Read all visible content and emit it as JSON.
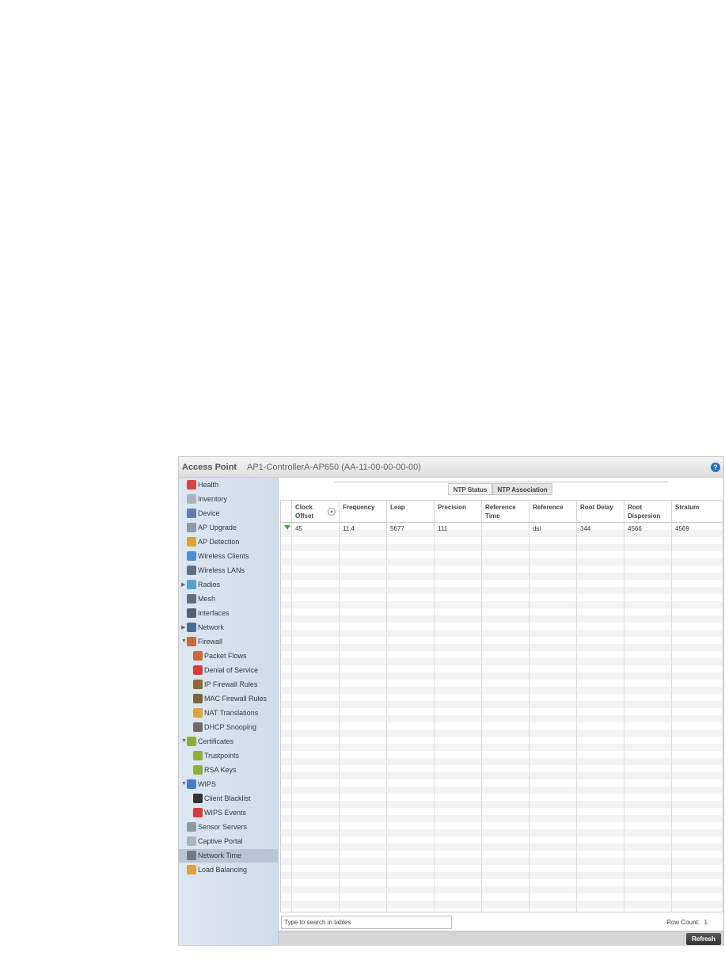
{
  "header": {
    "label": "Access Point",
    "device": "AP1-ControllerA-AP650 (AA-11-00-00-00-00)",
    "help_icon": "?"
  },
  "nav": [
    {
      "label": "Health",
      "icon": "health-icon",
      "color": "#d64545"
    },
    {
      "label": "Inventory",
      "icon": "inventory-icon",
      "color": "#a9b5c2"
    },
    {
      "label": "Device",
      "icon": "device-icon",
      "color": "#5a7fb0"
    },
    {
      "label": "AP Upgrade",
      "icon": "ap-upgrade-icon",
      "color": "#8e9aa6"
    },
    {
      "label": "AP Detection",
      "icon": "ap-detection-icon",
      "color": "#d9a43c"
    },
    {
      "label": "Wireless Clients",
      "icon": "wireless-clients-icon",
      "color": "#4a8fd1"
    },
    {
      "label": "Wireless LANs",
      "icon": "wireless-lans-icon",
      "color": "#607080"
    },
    {
      "label": "Radios",
      "icon": "radios-icon",
      "color": "#5aa0d0",
      "arrow": "▶"
    },
    {
      "label": "Mesh",
      "icon": "mesh-icon",
      "color": "#607080"
    },
    {
      "label": "Interfaces",
      "icon": "interfaces-icon",
      "color": "#556070"
    },
    {
      "label": "Network",
      "icon": "network-icon",
      "color": "#4e6a8e",
      "arrow": "▶"
    },
    {
      "label": "Firewall",
      "icon": "firewall-icon",
      "color": "#c96b3a",
      "arrow": "▼"
    },
    {
      "label": "Packet Flows",
      "icon": "packet-flows-icon",
      "color": "#c96b3a",
      "indent": true
    },
    {
      "label": "Denial of Service",
      "icon": "denial-of-service-icon",
      "color": "#d63b3b",
      "indent": true
    },
    {
      "label": "IP Firewall Rules",
      "icon": "ip-firewall-rules-icon",
      "color": "#8a6b3a",
      "indent": true
    },
    {
      "label": "MAC Firewall Rules",
      "icon": "mac-firewall-rules-icon",
      "color": "#7a6540",
      "indent": true
    },
    {
      "label": "NAT Translations",
      "icon": "nat-translations-icon",
      "color": "#d9a43c",
      "indent": true
    },
    {
      "label": "DHCP Snooping",
      "icon": "dhcp-snooping-icon",
      "color": "#6a6a6a",
      "indent": true
    },
    {
      "label": "Certificates",
      "icon": "certificates-icon",
      "color": "#8caf3e",
      "arrow": "▼"
    },
    {
      "label": "Trustpoints",
      "icon": "trustpoints-icon",
      "color": "#8caf3e",
      "indent": true
    },
    {
      "label": "RSA Keys",
      "icon": "rsa-keys-icon",
      "color": "#8caf3e",
      "indent": true
    },
    {
      "label": "WIPS",
      "icon": "wips-icon",
      "color": "#4a7fc0",
      "arrow": "▼"
    },
    {
      "label": "Client Blacklist",
      "icon": "client-blacklist-icon",
      "color": "#333333",
      "indent": true
    },
    {
      "label": "WIPS Events",
      "icon": "wips-events-icon",
      "color": "#d63b3b",
      "indent": true
    },
    {
      "label": "Sensor Servers",
      "icon": "sensor-servers-icon",
      "color": "#8e9aa6"
    },
    {
      "label": "Captive Portal",
      "icon": "captive-portal-icon",
      "color": "#a9b5c2"
    },
    {
      "label": "Network Time",
      "icon": "network-time-icon",
      "color": "#6f7a86",
      "active": true
    },
    {
      "label": "Load Balancing",
      "icon": "load-balancing-icon",
      "color": "#d9a43c"
    }
  ],
  "tabs": [
    {
      "label": "NTP Status",
      "active": false
    },
    {
      "label": "NTP Association",
      "active": true
    }
  ],
  "table": {
    "columns": [
      "Clock Offset",
      "Frequency",
      "Leap",
      "Precision",
      "Reference Time",
      "Reference",
      "Root Delay",
      "Root Dispersion",
      "Stratum"
    ],
    "rows": [
      [
        "45",
        "11.4",
        "5677",
        "111",
        "",
        "dsl",
        "344",
        "4566",
        "4569"
      ]
    ]
  },
  "search": {
    "placeholder": "Type to search in tables"
  },
  "row_count": {
    "label": "Row Count:",
    "value": "1"
  },
  "refresh_label": "Refresh"
}
